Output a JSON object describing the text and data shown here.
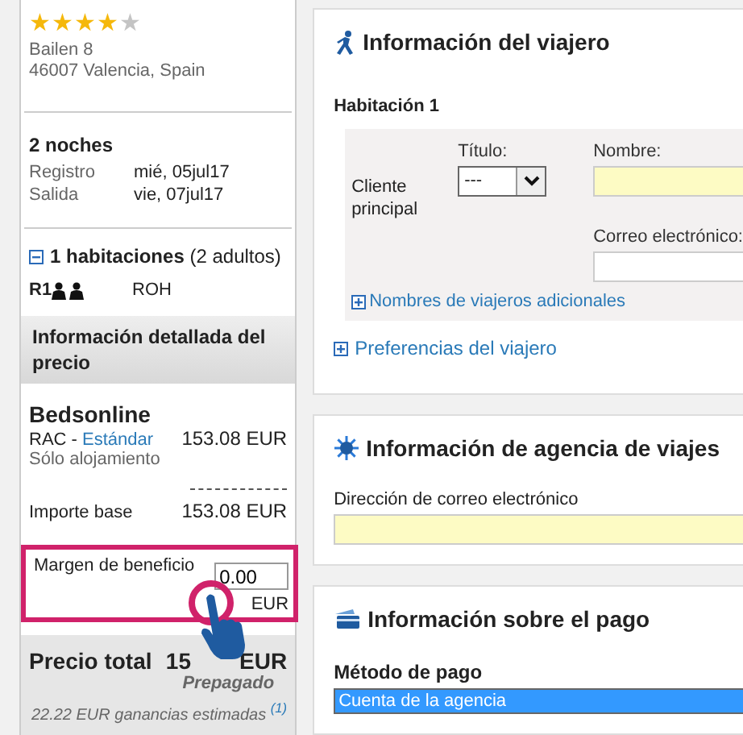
{
  "hotel": {
    "stars": 4,
    "address_lines": [
      "Bailen 8",
      "46007 Valencia, Spain"
    ]
  },
  "stay": {
    "nights": "2 noches",
    "dates": [
      {
        "label": "Registro",
        "value": "mié, 05jul17"
      },
      {
        "label": "Salida",
        "value": "vie, 07jul17"
      }
    ]
  },
  "rooms": {
    "expanded": true,
    "title": "1 habitaciones",
    "guests": "(2 adultos)",
    "items": [
      {
        "room": "R1",
        "guests": [
          {
            "kind": "adult"
          },
          {
            "kind": "adult"
          }
        ],
        "code": "ROH"
      }
    ]
  },
  "price_details": {
    "title": "Información detallada del precio",
    "supplier": "Bedsonline",
    "rate": "RAC - ",
    "rate_link": "Estándar",
    "rate_price": "153.08 EUR",
    "board": "Sólo alojamiento",
    "base_label": "Importe base",
    "base_price": "153.08 EUR"
  },
  "margin": {
    "label": "Margen de beneficio",
    "value": "0.00",
    "currency": "EUR"
  },
  "total": {
    "label": "Precio total",
    "amount": "15",
    "currency": "EUR",
    "payment": "Prepagado",
    "earnings": "22.22 EUR ganancias estimadas",
    "footnote": "(1)"
  },
  "traveler": {
    "title": "Información del viajero",
    "room": "Habitación 1",
    "guest_label": "Cliente principal",
    "title_label": "Título:",
    "title_value": "---",
    "name_label": "Nombre:",
    "email_label": "Correo electrónico:",
    "additional": {
      "expanded": false,
      "label": "Nombres de viajeros adicionales"
    },
    "preferences": {
      "expanded": false,
      "label": "Preferencias del viajero"
    }
  },
  "agency": {
    "title": "Información de agencia de viajes",
    "email_label": "Dirección de correo electrónico"
  },
  "payment": {
    "title": "Información sobre el pago",
    "method_label": "Método de pago",
    "method_value": "Cuenta de la agencia"
  }
}
